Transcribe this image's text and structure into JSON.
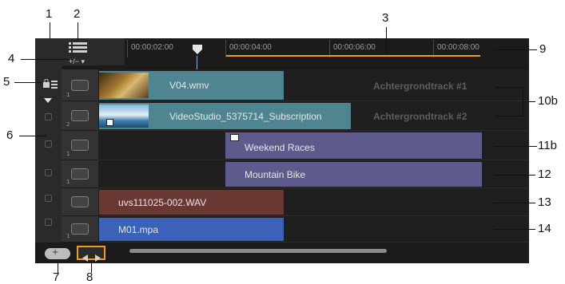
{
  "callouts": {
    "n1": "1",
    "n2": "2",
    "n3": "3",
    "n4": "4",
    "n5": "5",
    "n6": "6",
    "n7": "7",
    "n8": "8",
    "n9": "9",
    "n10b": "10b",
    "n11b": "11b",
    "n12": "12",
    "n13": "13",
    "n14": "14"
  },
  "toolbar": {
    "zoom_label": "+/− ▾"
  },
  "ruler": {
    "timecodes": [
      "00:00:02:00",
      "00:00:04:00",
      "00:00:06:00",
      "00:00:08:00"
    ]
  },
  "tracks": {
    "video1_clip": "V04.wmv",
    "video2_clip": "VideoStudio_5375714_Subscription",
    "bg_track_1": "Achtergrondtrack #1",
    "bg_track_2": "Achtergrondtrack #2",
    "overlay_clip": "Weekend Races",
    "title_clip": "Mountain Bike",
    "voice_clip": "uvs111025-002.WAV",
    "music_clip": "M01.mpa",
    "track_num_1": "1",
    "track_num_2": "2"
  },
  "colors": {
    "accent": "#f39a19",
    "video_clip": "#4e8590",
    "overlay_clip": "#5d5a8c",
    "voice_clip": "#6a3832",
    "music_clip": "#3a62b8",
    "playhead": "#8fb2d8"
  },
  "icons": {
    "timeline_view": "timeline-view-icon",
    "track_manager": "track-manager-icon",
    "video_track": "film-reel-icon",
    "overlay_track": "film-reel-icon",
    "title_track": "title-T-icon",
    "voice_track": "microphone-icon",
    "music_track": "music-note-icon",
    "lock": "lock-icon"
  }
}
